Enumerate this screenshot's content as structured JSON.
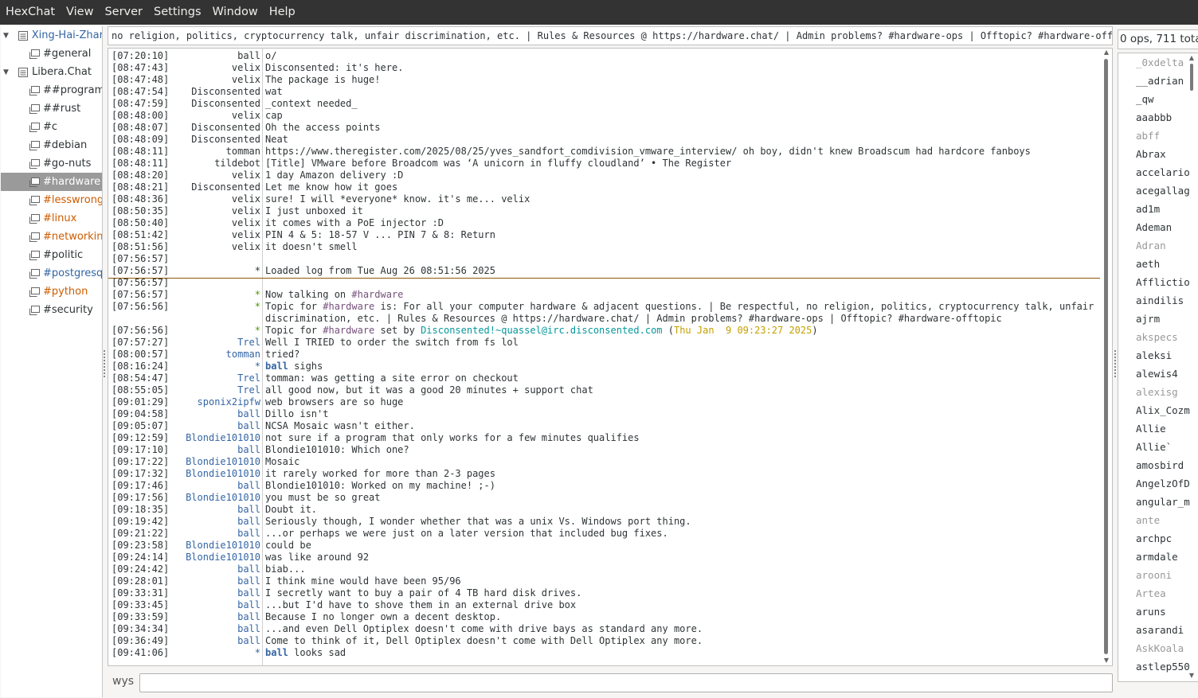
{
  "menubar": [
    "HexChat",
    "View",
    "Server",
    "Settings",
    "Window",
    "Help"
  ],
  "tree": [
    {
      "type": "server",
      "label": "Xing-Hai-Zhar",
      "color": "blue"
    },
    {
      "type": "channel",
      "label": "#general",
      "color": "dark"
    },
    {
      "type": "server",
      "label": "Libera.Chat",
      "color": "dark"
    },
    {
      "type": "channel",
      "label": "##programm",
      "color": "dark"
    },
    {
      "type": "channel",
      "label": "##rust",
      "color": "dark"
    },
    {
      "type": "channel",
      "label": "#c",
      "color": "dark"
    },
    {
      "type": "channel",
      "label": "#debian",
      "color": "dark"
    },
    {
      "type": "channel",
      "label": "#go-nuts",
      "color": "dark"
    },
    {
      "type": "channel",
      "label": "#hardware",
      "color": "dark",
      "selected": true
    },
    {
      "type": "channel",
      "label": "#lesswrong",
      "color": "orange"
    },
    {
      "type": "channel",
      "label": "#linux",
      "color": "orange"
    },
    {
      "type": "channel",
      "label": "#networkin",
      "color": "orange"
    },
    {
      "type": "channel",
      "label": "#politic",
      "color": "dark"
    },
    {
      "type": "channel",
      "label": "#postgresq",
      "color": "blue"
    },
    {
      "type": "channel",
      "label": "#python",
      "color": "orange"
    },
    {
      "type": "channel",
      "label": "#security",
      "color": "dark"
    }
  ],
  "topic": "no religion, politics, cryptocurrency talk, unfair discrimination, etc. | Rules & Resources @ https://hardware.chat/ | Admin problems? #hardware-ops | Offtopic? #hardware-offtopic",
  "chat": [
    {
      "ts": "[07:20:10]",
      "nick": "ball",
      "msg": [
        {
          "t": "o/"
        }
      ]
    },
    {
      "ts": "[08:47:43]",
      "nick": "velix",
      "msg": [
        {
          "t": "Disconsented: it's here."
        }
      ]
    },
    {
      "ts": "[08:47:48]",
      "nick": "velix",
      "msg": [
        {
          "t": "The package is huge!"
        }
      ]
    },
    {
      "ts": "[08:47:54]",
      "nick": "Disconsented",
      "msg": [
        {
          "t": "wat"
        }
      ]
    },
    {
      "ts": "[08:47:59]",
      "nick": "Disconsented",
      "msg": [
        {
          "t": "_context needed_"
        }
      ]
    },
    {
      "ts": "[08:48:00]",
      "nick": "velix",
      "msg": [
        {
          "t": "cap"
        }
      ]
    },
    {
      "ts": "[08:48:07]",
      "nick": "Disconsented",
      "msg": [
        {
          "t": "Oh the access points"
        }
      ]
    },
    {
      "ts": "[08:48:09]",
      "nick": "Disconsented",
      "msg": [
        {
          "t": "Neat"
        }
      ]
    },
    {
      "ts": "[08:48:11]",
      "nick": "tomman",
      "msg": [
        {
          "t": "https://www.theregister.com/2025/08/25/yves_sandfort_comdivision_vmware_interview/ oh boy, didn't knew Broadscum had hardcore fanboys"
        }
      ]
    },
    {
      "ts": "[08:48:11]",
      "nick": "tildebot",
      "msg": [
        {
          "t": "[Title] VMware before Broadcom was ‘A unicorn in fluffy cloudland’ • The Register"
        }
      ]
    },
    {
      "ts": "[08:48:20]",
      "nick": "velix",
      "msg": [
        {
          "t": "1 day Amazon delivery :D"
        }
      ]
    },
    {
      "ts": "[08:48:21]",
      "nick": "Disconsented",
      "msg": [
        {
          "t": "Let me know how it goes"
        }
      ]
    },
    {
      "ts": "[08:48:36]",
      "nick": "velix",
      "msg": [
        {
          "t": "sure! I will *everyone* know. it's me... velix"
        }
      ]
    },
    {
      "ts": "[08:50:35]",
      "nick": "velix",
      "msg": [
        {
          "t": "I just unboxed it"
        }
      ]
    },
    {
      "ts": "[08:50:40]",
      "nick": "velix",
      "msg": [
        {
          "t": "it comes with a PoE injector :D"
        }
      ]
    },
    {
      "ts": "[08:51:42]",
      "nick": "velix",
      "msg": [
        {
          "t": "PIN 4 & 5: 18-57 V ... PIN 7 & 8: Return"
        }
      ]
    },
    {
      "ts": "[08:51:56]",
      "nick": "velix",
      "msg": [
        {
          "t": "it doesn't smell"
        }
      ]
    },
    {
      "ts": "[07:56:57]",
      "nick": "",
      "msg": []
    },
    {
      "ts": "[07:56:57]",
      "nick": "*",
      "msg": [
        {
          "t": "Loaded log from Tue Aug 26 08:51:56 2025"
        }
      ],
      "marker_after": true
    },
    {
      "ts": "[07:56:57]",
      "nick": "",
      "msg": []
    },
    {
      "ts": "[07:56:57]",
      "nick": "*",
      "nickc": "green",
      "msg": [
        {
          "t": "Now talking on "
        },
        {
          "t": "#hardware",
          "c": "purple"
        }
      ]
    },
    {
      "ts": "[07:56:56]",
      "nick": "*",
      "nickc": "green",
      "tall": true,
      "msg": [
        {
          "t": "Topic for "
        },
        {
          "t": "#hardware",
          "c": "purple"
        },
        {
          "t": " is: For all your computer hardware & adjacent questions. | Be respectful, no religion, politics, cryptocurrency talk, unfair discrimination, etc. | Rules & Resources @ https://hardware.chat/ | Admin problems? #hardware-ops | Offtopic? #hardware-offtopic"
        }
      ]
    },
    {
      "ts": "[07:56:56]",
      "nick": "*",
      "nickc": "green",
      "msg": [
        {
          "t": "Topic for "
        },
        {
          "t": "#hardware",
          "c": "purple"
        },
        {
          "t": " set by "
        },
        {
          "t": "Disconsented!~quassel@irc.disconsented.com",
          "c": "teal"
        },
        {
          "t": " ("
        },
        {
          "t": "Thu Jan  9 09:23:27 2025",
          "c": "gold"
        },
        {
          "t": ")"
        }
      ]
    },
    {
      "ts": "[07:57:27]",
      "nick": "Trel",
      "nickc": "blue",
      "msg": [
        {
          "t": "Well I TRIED to order the switch from fs lol"
        }
      ]
    },
    {
      "ts": "[08:00:57]",
      "nick": "tomman",
      "nickc": "blue",
      "msg": [
        {
          "t": "tried?"
        }
      ]
    },
    {
      "ts": "[08:16:24]",
      "nick": "*",
      "nickc": "blue",
      "msg": [
        {
          "t": "ball",
          "c": "bold"
        },
        {
          "t": " sighs"
        }
      ]
    },
    {
      "ts": "[08:54:47]",
      "nick": "Trel",
      "nickc": "blue",
      "msg": [
        {
          "t": "tomman: was getting a site error on checkout"
        }
      ]
    },
    {
      "ts": "[08:55:05]",
      "nick": "Trel",
      "nickc": "blue",
      "msg": [
        {
          "t": "all good now, but it was a good 20 minutes + support chat"
        }
      ]
    },
    {
      "ts": "[09:01:29]",
      "nick": "sponix2ipfw",
      "nickc": "blue",
      "msg": [
        {
          "t": "web browsers are so huge"
        }
      ]
    },
    {
      "ts": "[09:04:58]",
      "nick": "ball",
      "nickc": "blue",
      "msg": [
        {
          "t": "Dillo isn't"
        }
      ]
    },
    {
      "ts": "[09:05:07]",
      "nick": "ball",
      "nickc": "blue",
      "msg": [
        {
          "t": "NCSA Mosaic wasn't either."
        }
      ]
    },
    {
      "ts": "[09:12:59]",
      "nick": "Blondie101010",
      "nickc": "blue",
      "msg": [
        {
          "t": "not sure if a program that only works for a few minutes qualifies"
        }
      ]
    },
    {
      "ts": "[09:17:10]",
      "nick": "ball",
      "nickc": "blue",
      "msg": [
        {
          "t": "Blondie101010: Which one?"
        }
      ]
    },
    {
      "ts": "[09:17:22]",
      "nick": "Blondie101010",
      "nickc": "blue",
      "msg": [
        {
          "t": "Mosaic"
        }
      ]
    },
    {
      "ts": "[09:17:32]",
      "nick": "Blondie101010",
      "nickc": "blue",
      "msg": [
        {
          "t": "it rarely worked for more than 2-3 pages"
        }
      ]
    },
    {
      "ts": "[09:17:46]",
      "nick": "ball",
      "nickc": "blue",
      "msg": [
        {
          "t": "Blondie101010: Worked on my machine! ;-)"
        }
      ]
    },
    {
      "ts": "[09:17:56]",
      "nick": "Blondie101010",
      "nickc": "blue",
      "msg": [
        {
          "t": "you must be so great"
        }
      ]
    },
    {
      "ts": "[09:18:35]",
      "nick": "ball",
      "nickc": "blue",
      "msg": [
        {
          "t": "Doubt it."
        }
      ]
    },
    {
      "ts": "[09:19:42]",
      "nick": "ball",
      "nickc": "blue",
      "msg": [
        {
          "t": "Seriously though, I wonder whether that was a unix Vs. Windows port thing."
        }
      ]
    },
    {
      "ts": "[09:21:22]",
      "nick": "ball",
      "nickc": "blue",
      "msg": [
        {
          "t": "...or perhaps we were just on a later version that included bug fixes."
        }
      ]
    },
    {
      "ts": "[09:23:58]",
      "nick": "Blondie101010",
      "nickc": "blue",
      "msg": [
        {
          "t": "could be"
        }
      ]
    },
    {
      "ts": "[09:24:14]",
      "nick": "Blondie101010",
      "nickc": "blue",
      "msg": [
        {
          "t": "was like around 92"
        }
      ]
    },
    {
      "ts": "[09:24:42]",
      "nick": "ball",
      "nickc": "blue",
      "msg": [
        {
          "t": "biab..."
        }
      ]
    },
    {
      "ts": "[09:28:01]",
      "nick": "ball",
      "nickc": "blue",
      "msg": [
        {
          "t": "I think mine would have been 95/96"
        }
      ]
    },
    {
      "ts": "[09:33:31]",
      "nick": "ball",
      "nickc": "blue",
      "msg": [
        {
          "t": "I secretly want to buy a pair of 4 TB hard disk drives."
        }
      ]
    },
    {
      "ts": "[09:33:45]",
      "nick": "ball",
      "nickc": "blue",
      "msg": [
        {
          "t": "...but I'd have to shove them in an external drive box"
        }
      ]
    },
    {
      "ts": "[09:33:59]",
      "nick": "ball",
      "nickc": "blue",
      "msg": [
        {
          "t": "Because I no longer own a decent desktop."
        }
      ]
    },
    {
      "ts": "[09:34:34]",
      "nick": "ball",
      "nickc": "blue",
      "msg": [
        {
          "t": "...and even Dell Optiplex doesn't come with drive bays as standard any more."
        }
      ]
    },
    {
      "ts": "[09:36:49]",
      "nick": "ball",
      "nickc": "blue",
      "msg": [
        {
          "t": "Come to think of it, Dell Optiplex doesn't come with Dell Optiplex any more."
        }
      ]
    },
    {
      "ts": "[09:41:06]",
      "nick": "*",
      "nickc": "blue",
      "msg": [
        {
          "t": "ball",
          "c": "bold"
        },
        {
          "t": " looks sad"
        }
      ]
    }
  ],
  "input": {
    "nick": "wys",
    "value": ""
  },
  "user_count": "0 ops, 711 tota",
  "users": [
    {
      "n": "_0xdelta",
      "away": true
    },
    {
      "n": "__adrian"
    },
    {
      "n": "_qw"
    },
    {
      "n": "aaabbb"
    },
    {
      "n": "abff",
      "away": true
    },
    {
      "n": "Abrax"
    },
    {
      "n": "accelario"
    },
    {
      "n": "acegallag"
    },
    {
      "n": "ad1m"
    },
    {
      "n": "Ademan"
    },
    {
      "n": "Adran",
      "away": true
    },
    {
      "n": "aeth"
    },
    {
      "n": "Afflictio"
    },
    {
      "n": "aindilis"
    },
    {
      "n": "ajrm"
    },
    {
      "n": "akspecs",
      "away": true
    },
    {
      "n": "aleksi"
    },
    {
      "n": "alewis4"
    },
    {
      "n": "alexisg",
      "away": true
    },
    {
      "n": "Alix_Cozm"
    },
    {
      "n": "Allie"
    },
    {
      "n": "Allie`"
    },
    {
      "n": "amosbird"
    },
    {
      "n": "AngelzOfD"
    },
    {
      "n": "angular_m"
    },
    {
      "n": "ante",
      "away": true
    },
    {
      "n": "archpc"
    },
    {
      "n": "armdale"
    },
    {
      "n": "arooni",
      "away": true
    },
    {
      "n": "Artea",
      "away": true
    },
    {
      "n": "aruns"
    },
    {
      "n": "asarandi"
    },
    {
      "n": "AskKoala",
      "away": true
    },
    {
      "n": "astlep550"
    }
  ],
  "colors": {
    "menubar_bg": "#333333",
    "selected_bg": "#9a9a9a",
    "nick_blue": "#3465a4",
    "nick_green": "#4e9a06",
    "channel_purple": "#75507b",
    "highlight_orange": "#ce5c00",
    "marker_line": "#8f5902"
  }
}
